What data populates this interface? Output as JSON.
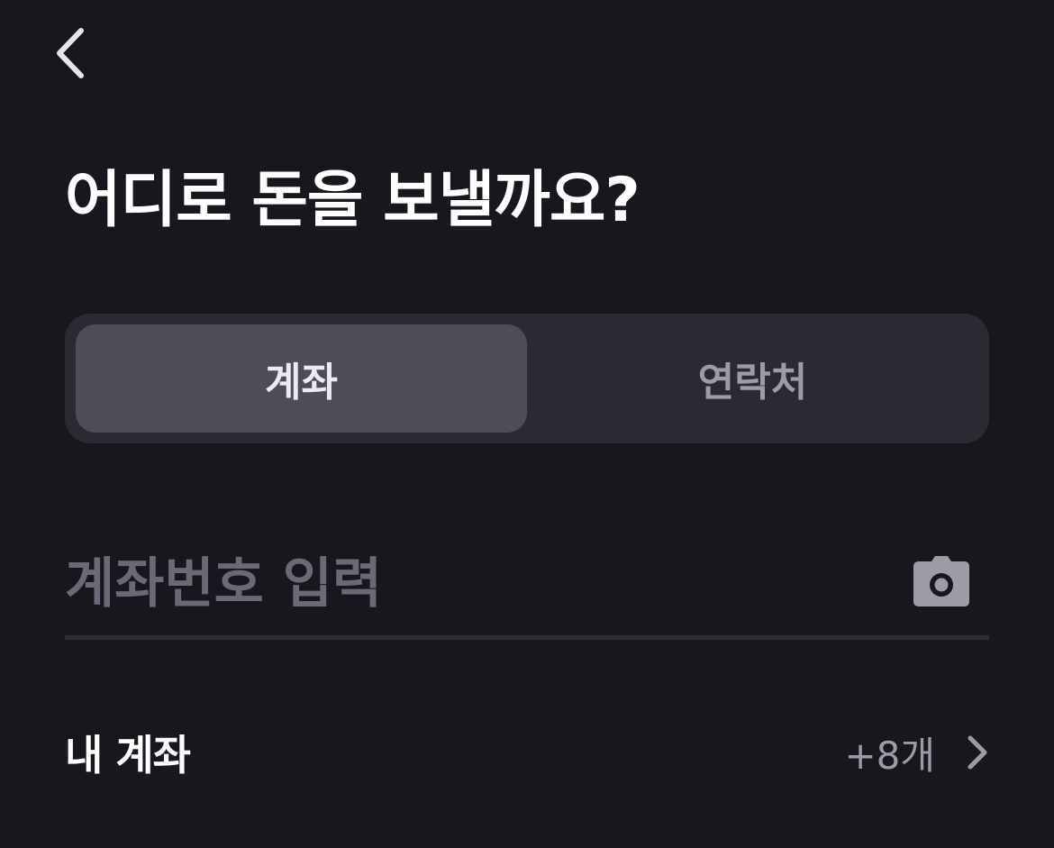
{
  "header": {
    "back_icon": "chevron-left-icon"
  },
  "title": "어디로 돈을 보낼까요?",
  "tabs": [
    {
      "label": "계좌",
      "selected": true
    },
    {
      "label": "연락처",
      "selected": false
    }
  ],
  "account_input": {
    "value": "",
    "placeholder": "계좌번호 입력",
    "icon": "camera-icon"
  },
  "my_accounts": {
    "label": "내 계좌",
    "count": "+8개",
    "icon": "chevron-right-icon"
  },
  "colors": {
    "background": "#18171e",
    "segment_track": "#2b2a33",
    "segment_active": "#4d4c58",
    "muted_text": "#9c9ba6",
    "placeholder": "#6a6975",
    "divider": "#2e2d36"
  }
}
